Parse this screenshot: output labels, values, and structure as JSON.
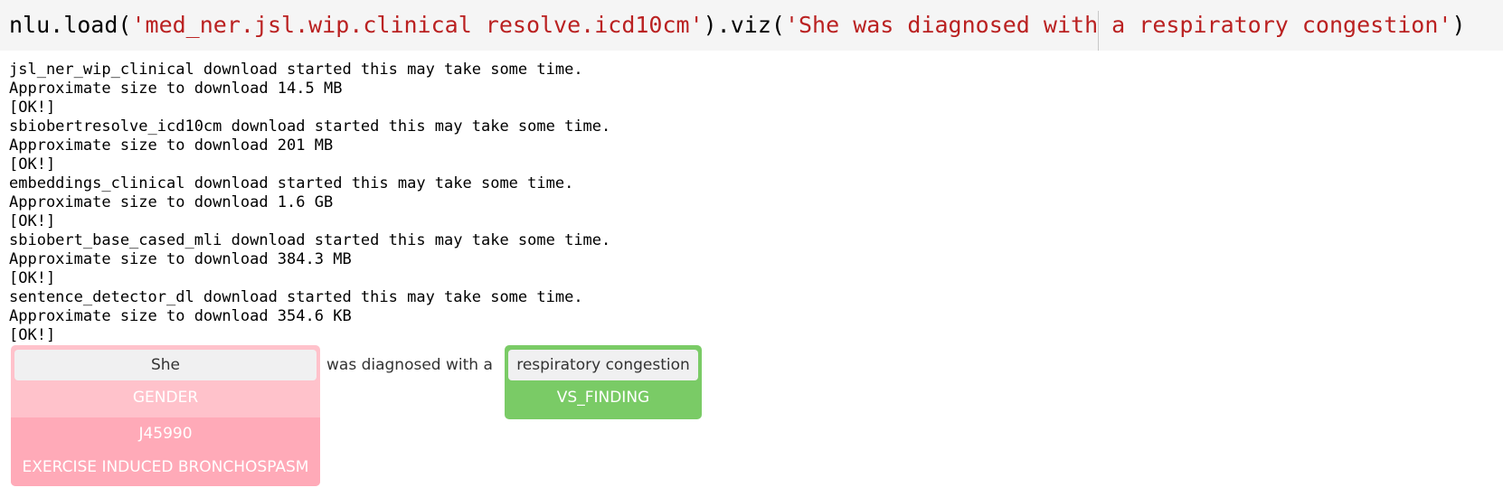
{
  "input": {
    "prefix": "nlu.load(",
    "model_string": "'med_ner.jsl.wip.clinical resolve.icd10cm'",
    "mid": ").viz(",
    "text_string": "'She was diagnosed with a respiratory congestion'",
    "suffix": ")"
  },
  "output_lines": [
    "jsl_ner_wip_clinical download started this may take some time.",
    "Approximate size to download 14.5 MB",
    "[OK!]",
    "sbiobertresolve_icd10cm download started this may take some time.",
    "Approximate size to download 201 MB",
    "[OK!]",
    "embeddings_clinical download started this may take some time.",
    "Approximate size to download 1.6 GB",
    "[OK!]",
    "sbiobert_base_cased_mli download started this may take some time.",
    "Approximate size to download 384.3 MB",
    "[OK!]",
    "sentence_detector_dl download started this may take some time.",
    "Approximate size to download 354.6 KB",
    "[OK!]"
  ],
  "viz": {
    "entity1": {
      "chunk": "She",
      "label": "GENDER",
      "resolution_code": "J45990",
      "resolution_desc": "EXERCISE INDUCED BRONCHOSPASM"
    },
    "plain_text": "was diagnosed with a",
    "entity2": {
      "chunk": "respiratory congestion",
      "label": "VS_FINDING"
    }
  },
  "colors": {
    "gender_bg": "#ffc2cb",
    "resolution_bg": "#ffaab8",
    "vs_finding_bg": "#7acb66",
    "string_literal": "#ba2121"
  }
}
